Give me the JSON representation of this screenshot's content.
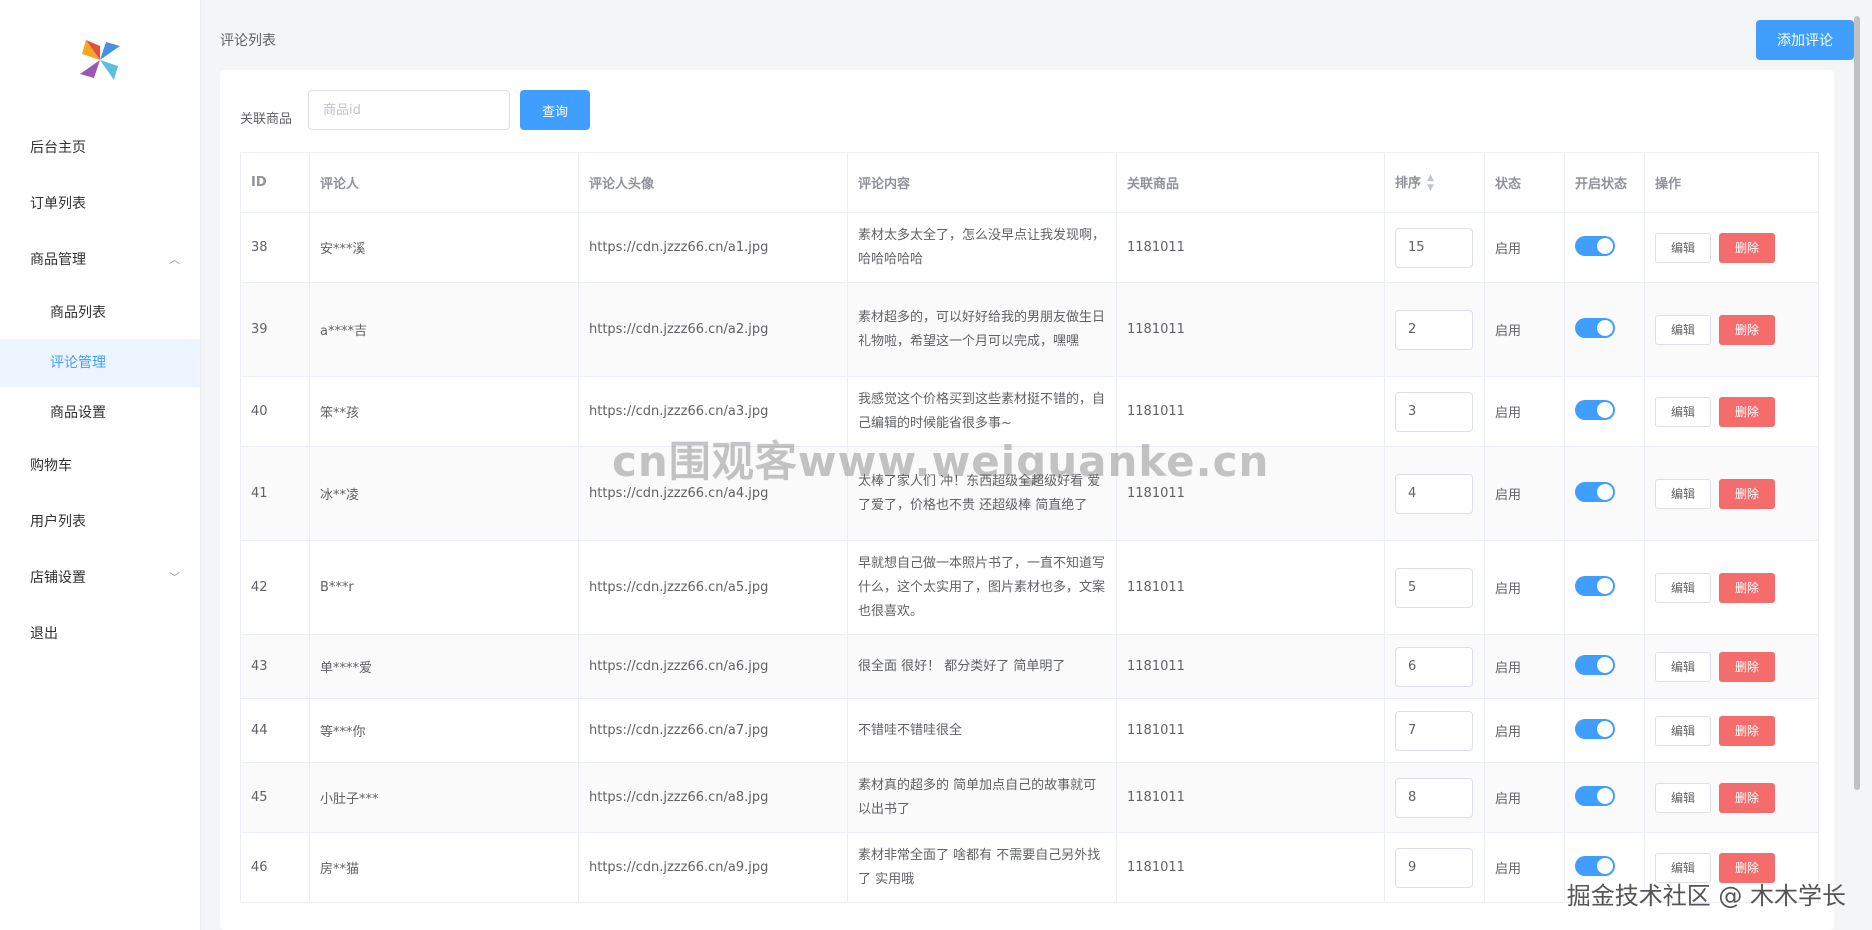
{
  "sidebar": {
    "items": [
      {
        "label": "后台主页"
      },
      {
        "label": "订单列表"
      },
      {
        "label": "商品管理"
      },
      {
        "label": "商品列表"
      },
      {
        "label": "评论管理"
      },
      {
        "label": "商品设置"
      },
      {
        "label": "购物车"
      },
      {
        "label": "用户列表"
      },
      {
        "label": "店铺设置"
      },
      {
        "label": "退出"
      }
    ]
  },
  "header": {
    "title": "评论列表",
    "add_button": "添加评论"
  },
  "filter": {
    "label": "关联商品",
    "placeholder": "商品id",
    "query_button": "查询"
  },
  "table": {
    "columns": [
      "ID",
      "评论人",
      "评论人头像",
      "评论内容",
      "关联商品",
      "排序",
      "状态",
      "开启状态",
      "操作"
    ],
    "rows": [
      {
        "id": "38",
        "name": "安***溪",
        "avatar": "https://cdn.jzzz66.cn/a1.jpg",
        "content": "素材太多太全了，怎么没早点让我发现啊，哈哈哈哈哈",
        "product": "1181011",
        "sort": "15",
        "status": "启用"
      },
      {
        "id": "39",
        "name": "a****吉",
        "avatar": "https://cdn.jzzz66.cn/a2.jpg",
        "content": "素材超多的，可以好好给我的男朋友做生日礼物啦，希望这一个月可以完成，嘿嘿",
        "product": "1181011",
        "sort": "2",
        "status": "启用"
      },
      {
        "id": "40",
        "name": "笨**孩",
        "avatar": "https://cdn.jzzz66.cn/a3.jpg",
        "content": "我感觉这个价格买到这些素材挺不错的，自己编辑的时候能省很多事~",
        "product": "1181011",
        "sort": "3",
        "status": "启用"
      },
      {
        "id": "41",
        "name": "冰**凌",
        "avatar": "https://cdn.jzzz66.cn/a4.jpg",
        "content": "太棒了家人们 冲！东西超级全超级好看 爱了爱了，价格也不贵 还超级棒 简直绝了",
        "product": "1181011",
        "sort": "4",
        "status": "启用"
      },
      {
        "id": "42",
        "name": "B***r",
        "avatar": "https://cdn.jzzz66.cn/a5.jpg",
        "content": "早就想自己做一本照片书了，一直不知道写什么，这个太实用了，图片素材也多，文案也很喜欢。",
        "product": "1181011",
        "sort": "5",
        "status": "启用"
      },
      {
        "id": "43",
        "name": "单****爱",
        "avatar": "https://cdn.jzzz66.cn/a6.jpg",
        "content": "很全面 很好！ 都分类好了 简单明了",
        "product": "1181011",
        "sort": "6",
        "status": "启用"
      },
      {
        "id": "44",
        "name": "等***你",
        "avatar": "https://cdn.jzzz66.cn/a7.jpg",
        "content": "不错哇不错哇很全",
        "product": "1181011",
        "sort": "7",
        "status": "启用"
      },
      {
        "id": "45",
        "name": "小肚子***",
        "avatar": "https://cdn.jzzz66.cn/a8.jpg",
        "content": "素材真的超多的 简单加点自己的故事就可以出书了",
        "product": "1181011",
        "sort": "8",
        "status": "启用"
      },
      {
        "id": "46",
        "name": "房**猫",
        "avatar": "https://cdn.jzzz66.cn/a9.jpg",
        "content": "素材非常全面了 啥都有 不需要自己另外找了 实用哦",
        "product": "1181011",
        "sort": "9",
        "status": "启用"
      }
    ],
    "edit_label": "编辑",
    "delete_label": "删除"
  },
  "watermarks": {
    "center": "cn围观客www.weiguanke.cn",
    "corner": "掘金技术社区 @ 木木学长"
  },
  "colors": {
    "primary": "#409eff",
    "danger": "#f56c6c",
    "active_bg": "#ecf5ff"
  }
}
